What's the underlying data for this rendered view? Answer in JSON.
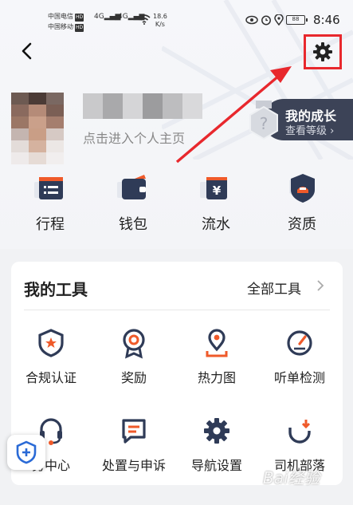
{
  "status_bar": {
    "carrier1": "中国电信",
    "carrier2": "中国移动",
    "hd_badge": "HD",
    "signal1": "4G",
    "signal2": "4G",
    "speed_value": "18.6",
    "speed_unit": "K/s",
    "battery": "88",
    "time": "8:46"
  },
  "profile": {
    "home_link": "点击进入个人主页"
  },
  "growth": {
    "title": "我的成长",
    "subtitle": "查看等级",
    "chevron": "›"
  },
  "quick_actions": [
    {
      "label": "行程",
      "icon": "trip-list-icon"
    },
    {
      "label": "钱包",
      "icon": "wallet-icon"
    },
    {
      "label": "流水",
      "icon": "cash-flow-icon"
    },
    {
      "label": "资质",
      "icon": "qualification-shield-icon"
    }
  ],
  "tools": {
    "title": "我的工具",
    "all_label": "全部工具",
    "items": [
      {
        "label": "合规认证",
        "icon": "compliance-shield-icon"
      },
      {
        "label": "奖励",
        "icon": "reward-medal-icon"
      },
      {
        "label": "热力图",
        "icon": "heatmap-pin-icon"
      },
      {
        "label": "听单检测",
        "icon": "gauge-icon"
      },
      {
        "label": "务中心",
        "icon": "headset-icon"
      },
      {
        "label": "处置与申诉",
        "icon": "appeal-message-icon"
      },
      {
        "label": "导航设置",
        "icon": "nav-gear-icon"
      },
      {
        "label": "司机部落",
        "icon": "tribe-icon"
      }
    ]
  },
  "watermark": "Bai经验",
  "colors": {
    "accent_orange": "#ef5a2a",
    "dark_navy": "#3c4357",
    "highlight_red": "#e8282d",
    "growth_bg": "#3c4357"
  }
}
